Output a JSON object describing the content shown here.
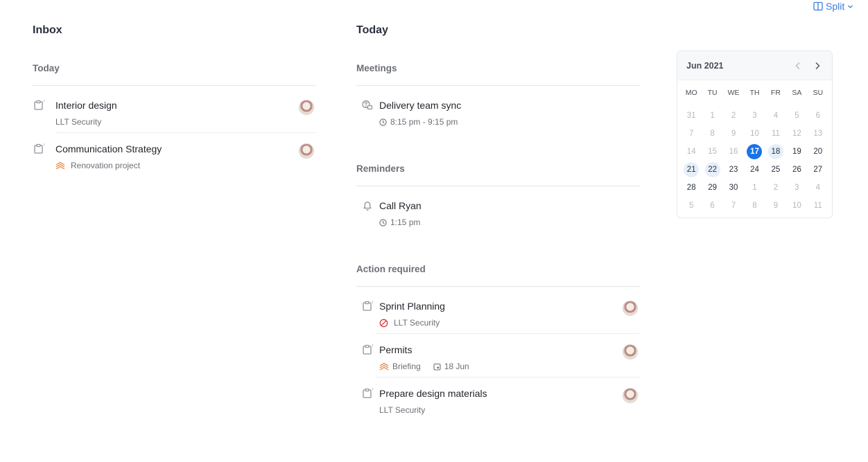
{
  "toolbar": {
    "split_label": "Split"
  },
  "inbox": {
    "title": "Inbox",
    "section": "Today",
    "items": [
      {
        "title": "Interior design",
        "subtitle": "LLT Security"
      },
      {
        "title": "Communication Strategy",
        "subtitle": "Renovation project"
      }
    ]
  },
  "today": {
    "title": "Today",
    "meetings": {
      "label": "Meetings",
      "items": [
        {
          "title": "Delivery team sync",
          "time": "8:15 pm - 9:15 pm"
        }
      ]
    },
    "reminders": {
      "label": "Reminders",
      "items": [
        {
          "title": "Call Ryan",
          "time": "1:15 pm"
        }
      ]
    },
    "actions": {
      "label": "Action required",
      "items": [
        {
          "title": "Sprint Planning",
          "subtitle": "LLT Security"
        },
        {
          "title": "Permits",
          "subtitle": "Briefing",
          "date": "18 Jun"
        },
        {
          "title": "Prepare design materials",
          "subtitle": "LLT Security"
        }
      ]
    }
  },
  "calendar": {
    "month_label": "Jun 2021",
    "weekdays": [
      "MO",
      "TU",
      "WE",
      "TH",
      "FR",
      "SA",
      "SU"
    ],
    "selected_day": "17",
    "days": [
      {
        "d": "31",
        "m": true
      },
      {
        "d": "1",
        "m": true
      },
      {
        "d": "2",
        "m": true
      },
      {
        "d": "3",
        "m": true
      },
      {
        "d": "4",
        "m": true
      },
      {
        "d": "5",
        "m": true
      },
      {
        "d": "6",
        "m": true
      },
      {
        "d": "7",
        "m": true
      },
      {
        "d": "8",
        "m": true
      },
      {
        "d": "9",
        "m": true
      },
      {
        "d": "10",
        "m": true
      },
      {
        "d": "11",
        "m": true
      },
      {
        "d": "12",
        "m": true
      },
      {
        "d": "13",
        "m": true
      },
      {
        "d": "14",
        "m": true
      },
      {
        "d": "15",
        "m": true
      },
      {
        "d": "16",
        "m": true
      },
      {
        "d": "17",
        "sel": true
      },
      {
        "d": "18",
        "hl": true
      },
      {
        "d": "19"
      },
      {
        "d": "20"
      },
      {
        "d": "21",
        "hl": true
      },
      {
        "d": "22",
        "hl": true
      },
      {
        "d": "23"
      },
      {
        "d": "24"
      },
      {
        "d": "25"
      },
      {
        "d": "26"
      },
      {
        "d": "27"
      },
      {
        "d": "28"
      },
      {
        "d": "29"
      },
      {
        "d": "30"
      },
      {
        "d": "1",
        "m": true
      },
      {
        "d": "2",
        "m": true
      },
      {
        "d": "3",
        "m": true
      },
      {
        "d": "4",
        "m": true
      },
      {
        "d": "5",
        "m": true
      },
      {
        "d": "6",
        "m": true
      },
      {
        "d": "7",
        "m": true
      },
      {
        "d": "8",
        "m": true
      },
      {
        "d": "9",
        "m": true
      },
      {
        "d": "10",
        "m": true
      },
      {
        "d": "11",
        "m": true
      }
    ]
  },
  "colors": {
    "accent": "#1a73e8",
    "priority": "#e8823c",
    "blocked": "#d93a3a"
  }
}
